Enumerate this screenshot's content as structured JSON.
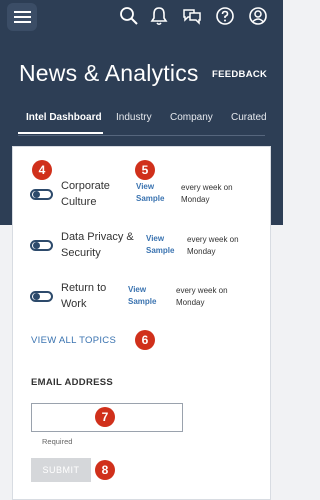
{
  "header": {
    "title": "News & Analytics",
    "feedback_label": "FEEDBACK",
    "icons": [
      "menu-icon",
      "search-icon",
      "bell-icon",
      "chat-icon",
      "help-icon",
      "user-icon"
    ]
  },
  "tabs": [
    {
      "label": "Intel Dashboard",
      "active": true
    },
    {
      "label": "Industry",
      "active": false
    },
    {
      "label": "Company",
      "active": false
    },
    {
      "label": "Curated",
      "active": false
    }
  ],
  "topics": [
    {
      "label_lines": [
        "Corporate",
        "Culture"
      ],
      "sample_lines": [
        "View",
        "Sample"
      ],
      "frequency_lines": [
        "every week on",
        "Monday"
      ],
      "enabled": false
    },
    {
      "label_lines": [
        "Data Privacy &",
        "Security"
      ],
      "sample_lines": [
        "View",
        "Sample"
      ],
      "frequency_lines": [
        "every week on",
        "Monday"
      ],
      "enabled": false
    },
    {
      "label_lines": [
        "Return to",
        "Work"
      ],
      "sample_lines": [
        "View",
        "Sample"
      ],
      "frequency_lines": [
        "every week on",
        "Monday"
      ],
      "enabled": false
    }
  ],
  "view_all_label": "VIEW ALL TOPICS",
  "email": {
    "heading": "EMAIL ADDRESS",
    "value": "",
    "helper": "Required",
    "submit_label": "SUBMIT"
  },
  "markers": [
    "4",
    "5",
    "6",
    "7",
    "8"
  ],
  "colors": {
    "header_bg": "#2d3e55",
    "accent_link": "#3a73b0",
    "marker_red": "#d0301b",
    "toggle_navy": "#2d4a6b"
  }
}
